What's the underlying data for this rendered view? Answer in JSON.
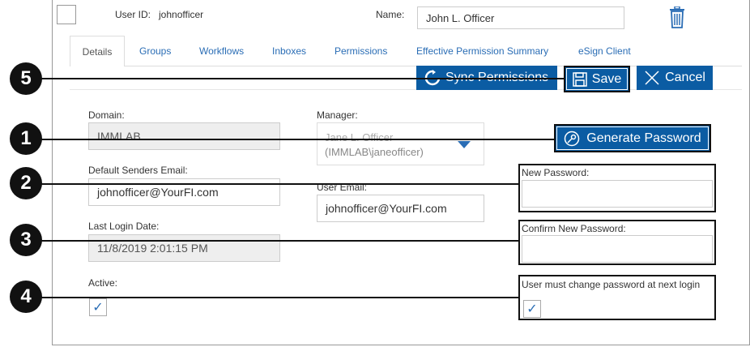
{
  "header": {
    "user_id_label": "User ID:",
    "user_id_value": "johnofficer",
    "name_label": "Name:",
    "name_value": "John L. Officer",
    "delete_icon": "trash-icon"
  },
  "tabs": [
    "Details",
    "Groups",
    "Workflows",
    "Inboxes",
    "Permissions",
    "Effective Permission Summary",
    "eSign Client"
  ],
  "toolbar": {
    "sync_label": "Sync Permissions",
    "save_label": "Save",
    "cancel_label": "Cancel"
  },
  "form": {
    "domain_label": "Domain:",
    "domain_value": "IMMLAB",
    "manager_label": "Manager:",
    "manager_value_line1": "Jane L. Officer",
    "manager_value_line2": "(IMMLAB\\janeofficer)",
    "senders_email_label": "Default Senders Email:",
    "senders_email_value": "johnofficer@YourFI.com",
    "user_email_label": "User Email:",
    "user_email_value": "johnofficer@YourFI.com",
    "last_login_label": "Last Login Date:",
    "last_login_value": "11/8/2019 2:01:15 PM",
    "active_label": "Active:",
    "generate_password_label": "Generate Password",
    "new_password_label": "New Password:",
    "confirm_password_label": "Confirm New Password:",
    "must_change_label": "User must change password at next login"
  },
  "callouts": [
    "5",
    "1",
    "2",
    "3",
    "4"
  ],
  "colors": {
    "accent": "#0b5ca3",
    "tab_text": "#2a6db5"
  }
}
